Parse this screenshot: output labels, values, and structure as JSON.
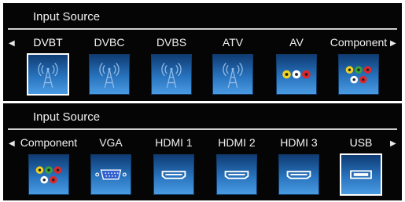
{
  "panels": [
    {
      "title": "Input Source",
      "left_arrow": "◀",
      "right_arrow": "▶",
      "items": [
        {
          "label": "DVBT",
          "icon": "antenna-icon",
          "selected": true
        },
        {
          "label": "DVBC",
          "icon": "antenna-icon",
          "selected": false
        },
        {
          "label": "DVBS",
          "icon": "antenna-icon",
          "selected": false
        },
        {
          "label": "ATV",
          "icon": "antenna-icon",
          "selected": false
        },
        {
          "label": "AV",
          "icon": "rca-connector-icon",
          "selected": false
        },
        {
          "label": "Component",
          "icon": "component-connector-icon",
          "selected": false
        }
      ]
    },
    {
      "title": "Input Source",
      "left_arrow": "◀",
      "right_arrow": "▶",
      "items": [
        {
          "label": "Component",
          "icon": "component-connector-icon",
          "selected": false
        },
        {
          "label": "VGA",
          "icon": "vga-connector-icon",
          "selected": false
        },
        {
          "label": "HDMI 1",
          "icon": "hdmi-connector-icon",
          "selected": false
        },
        {
          "label": "HDMI 2",
          "icon": "hdmi-connector-icon",
          "selected": false
        },
        {
          "label": "HDMI 3",
          "icon": "hdmi-connector-icon",
          "selected": false
        },
        {
          "label": "USB",
          "icon": "usb-connector-icon",
          "selected": true
        }
      ]
    }
  ],
  "colors": {
    "panel_bg": "#050505",
    "tile_top": "#0f3c74",
    "tile_bottom": "#4a9be3",
    "rca_yellow": "#f2d21b",
    "rca_white": "#ffffff",
    "rca_red": "#e0262a",
    "rca_green": "#3aa33a",
    "rca_blue": "#2f5fd0"
  }
}
